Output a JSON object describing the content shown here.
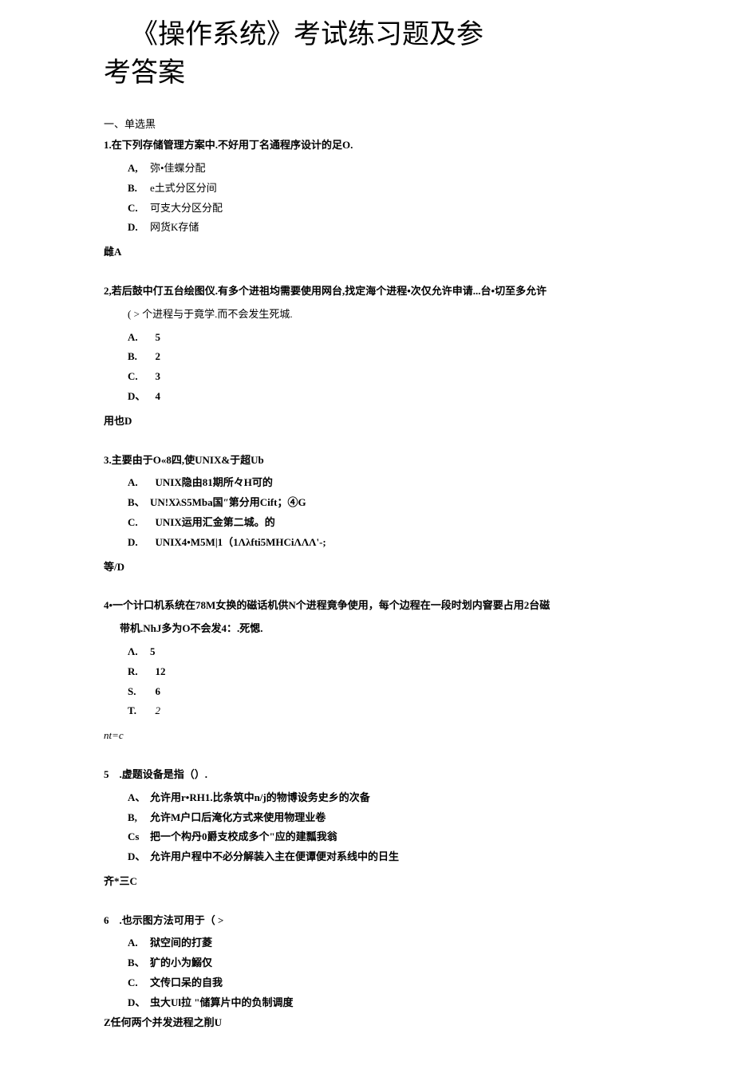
{
  "title_line1": "《操作系统》考试练习题及参",
  "title_line2": "考答案",
  "section1_header": "一、单选黑",
  "q1": {
    "text": "1.在下列存储管理方案中.不好用丁名通程序设计的足O.",
    "options": [
      {
        "label": "A,",
        "text": "弥•佳蝶分配"
      },
      {
        "label": "B.",
        "text": "e土式分区分间"
      },
      {
        "label": "C.",
        "text": "可支大分区分配"
      },
      {
        "label": "D.",
        "text": "网货K存储"
      }
    ],
    "answer": "雌A"
  },
  "q2": {
    "text": "2,若后鼓中仃五台绘图仪.有多个进祖均需要使用网台,找定海个进程•次仅允许申请...台•切至多允许",
    "text_cont": "( > 个进程与于竟学.而不会发生死城.",
    "options": [
      {
        "label": "A.",
        "text": "5"
      },
      {
        "label": "B.",
        "text": "2"
      },
      {
        "label": "C.",
        "text": "3"
      },
      {
        "label": "D、",
        "text": "4"
      }
    ],
    "answer": "用也D"
  },
  "q3": {
    "text": "3.主要由于O«8四,使UNIX&于超Ub",
    "options": [
      {
        "label": "A.",
        "text": "UNIX隐由81期所々H可的"
      },
      {
        "label": "B、",
        "text": "UN!XλS5Mba国″第分用Cift；④G"
      },
      {
        "label": "C.",
        "text": "UNIX运用汇金第二城。的"
      },
      {
        "label": "D.",
        "text": "UNIX4•M5M|1（1Λλfti5MHCiΛΛΛ'-;"
      }
    ],
    "answer": "等/D"
  },
  "q4": {
    "text": "4•一个计口机系统在78M女换的磁话机供N个进程竟争使用，每个边程在一段时划内窨要占用2台磁",
    "text_cont": "带机.NhJ多为O不会发4：.死愢.",
    "options": [
      {
        "label": "Λ.",
        "text": "5"
      },
      {
        "label": "R.",
        "text": "12"
      },
      {
        "label": "S.",
        "text": "6"
      },
      {
        "label": "T.",
        "text": "2",
        "italic": true
      }
    ],
    "answer": "nt=c",
    "answer_italic": true
  },
  "q5": {
    "text": "5　.虚题设备是指（）.",
    "options": [
      {
        "label": "A、",
        "text": "允许用r•RH1.比条筑中n/j的物博设务史乡的次备"
      },
      {
        "label": "B,",
        "text": "允许M户口后淹化方式来使用物理业卷"
      },
      {
        "label": "Cs",
        "text": "把一个构丹0爵支校成多个\"应的建瓢我翁"
      },
      {
        "label": "D、",
        "text": "允许用户程中不必分解装入主在便谭便对系线中的日生"
      }
    ],
    "answer": "齐*三C"
  },
  "q6": {
    "text": "6　.也示图方法可用于（ >",
    "options": [
      {
        "label": "A.",
        "text": "狱空间的打菱"
      },
      {
        "label": "B、",
        "text": "犷的小为鰯仅"
      },
      {
        "label": "C.",
        "text": "文传口呆的自我"
      },
      {
        "label": "D、",
        "text": "虫大Ul拉 \"储算片中的负制调度"
      }
    ],
    "answer": "Z任何两个并发进程之削U"
  }
}
